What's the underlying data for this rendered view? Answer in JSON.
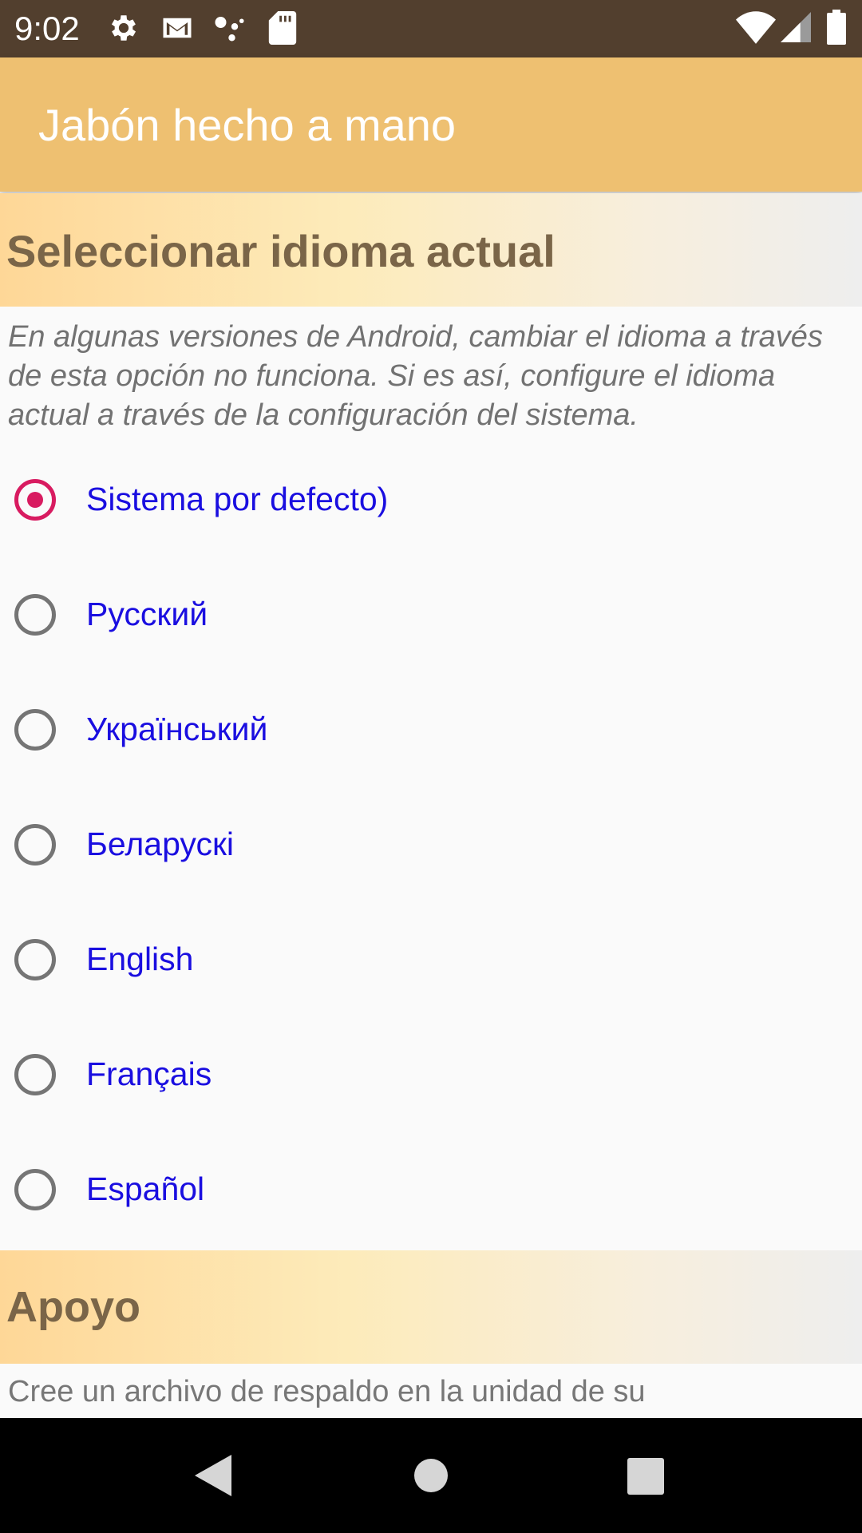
{
  "status_bar": {
    "time": "9:02",
    "icons_left": [
      "gear-icon",
      "gmail-icon",
      "assistant-dots-icon",
      "sd-card-icon"
    ],
    "icons_right": [
      "wifi-icon",
      "signal-icon",
      "battery-icon"
    ]
  },
  "app_bar": {
    "title": "Jabón hecho a mano",
    "color": "#eec071"
  },
  "language_section": {
    "title": "Seleccionar idioma actual",
    "notice": "En algunas versiones de Android, cambiar el idioma a través de esta opción no funciona. Si es así, configure el idioma actual a través de la configuración del sistema.",
    "options": [
      {
        "label": "Sistema por defecto)",
        "selected": true
      },
      {
        "label": "Русский",
        "selected": false
      },
      {
        "label": "Український",
        "selected": false
      },
      {
        "label": "Беларускі",
        "selected": false
      },
      {
        "label": "English",
        "selected": false
      },
      {
        "label": "Français",
        "selected": false
      },
      {
        "label": "Español",
        "selected": false
      }
    ]
  },
  "backup_section": {
    "title": "Apoyo",
    "text": "Cree un archivo de respaldo en la unidad de su"
  },
  "nav_bar": {
    "buttons": [
      "back-icon",
      "home-icon",
      "recents-icon"
    ]
  },
  "colors": {
    "accent": "#d81b60",
    "link": "#1a0ee0",
    "status_bar": "#523f2e"
  }
}
